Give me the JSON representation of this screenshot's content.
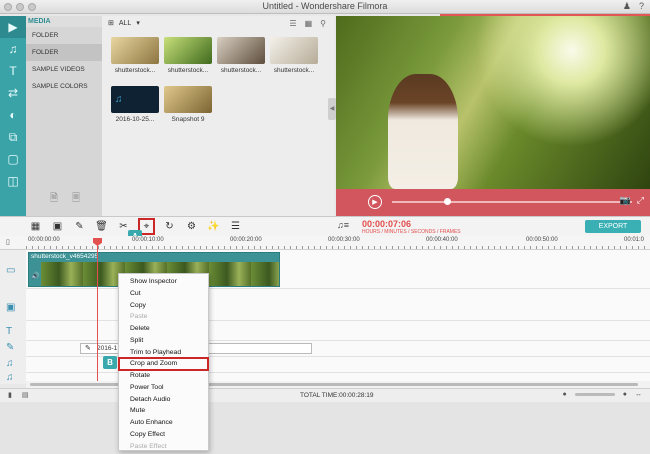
{
  "window": {
    "title": "Untitled - Wondershare Filmora"
  },
  "sidebar": {
    "icons": [
      "media-icon",
      "music-icon",
      "text-icon",
      "transition-icon",
      "filter-icon",
      "overlay-icon",
      "elements-icon",
      "split-screen-icon"
    ]
  },
  "media_panel": {
    "header": "MEDIA",
    "items": [
      {
        "label": "FOLDER"
      },
      {
        "label": "FOLDER"
      },
      {
        "label": "SAMPLE VIDEOS"
      },
      {
        "label": "SAMPLE COLORS"
      }
    ]
  },
  "library": {
    "filter": "ALL",
    "thumbnails": [
      {
        "caption": "shutterstock...",
        "color": "#c9b27d"
      },
      {
        "caption": "shutterstock...",
        "color": "#7fae4a"
      },
      {
        "caption": "shutterstock...",
        "color": "#a49784"
      },
      {
        "caption": "shutterstock...",
        "color": "#d8d2c4"
      },
      {
        "caption": "2016-10-25...",
        "color": "#0e2233"
      },
      {
        "caption": "Snapshot 9",
        "color": "#b3a072"
      }
    ]
  },
  "timeline": {
    "timecode": "00:00:07:06",
    "timecode_units": "HOURS / MINUTES / SECONDS / FRAMES",
    "export_label": "EXPORT",
    "ruler_ticks": [
      "00:00:00:00",
      "00:00:10:00",
      "00:00:20:00",
      "00:00:30:00",
      "00:00:40:00",
      "00:00:50:00",
      "00:01:0"
    ],
    "video_clip": "shutterstock_v4654295",
    "text_clip": "2016-1",
    "total_time": "TOTAL TIME:00:00:28:19",
    "badge_a": "A",
    "badge_b": "B"
  },
  "context_menu": {
    "items": [
      {
        "label": "Show Inspector",
        "enabled": true
      },
      {
        "label": "Cut",
        "enabled": true
      },
      {
        "label": "Copy",
        "enabled": true
      },
      {
        "label": "Paste",
        "enabled": false
      },
      {
        "label": "Delete",
        "enabled": true
      },
      {
        "label": "Split",
        "enabled": true
      },
      {
        "label": "Trim to Playhead",
        "enabled": true
      },
      {
        "label": "Crop and Zoom",
        "enabled": true,
        "highlighted": true
      },
      {
        "label": "Rotate",
        "enabled": true
      },
      {
        "label": "Power Tool",
        "enabled": true
      },
      {
        "label": "Detach Audio",
        "enabled": true
      },
      {
        "label": "Mute",
        "enabled": true
      },
      {
        "label": "Auto Enhance",
        "enabled": true
      },
      {
        "label": "Copy Effect",
        "enabled": true
      },
      {
        "label": "Paste Effect",
        "enabled": false
      }
    ]
  },
  "colors": {
    "accent": "#3aa3a8",
    "highlight": "#cc2727",
    "player_bar": "#d1565e"
  }
}
